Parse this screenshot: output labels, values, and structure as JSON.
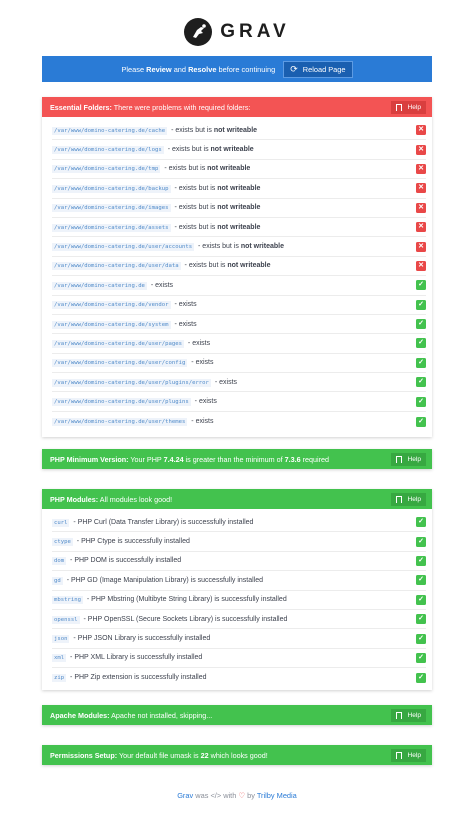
{
  "header": {
    "logo_text": "GRAV"
  },
  "review_bar": {
    "prefix": "Please ",
    "review": "Review",
    "and": " and ",
    "resolve": "Resolve",
    "suffix": " before continuing",
    "reload_label": "Reload Page",
    "reload_icon": "refresh-icon"
  },
  "help_label": "Help",
  "folders": {
    "title": "Essential Folders:",
    "message": " There were problems with required folders:",
    "color": "#f35454",
    "rows": [
      {
        "path": "/var/www/domino-catering.de/cache",
        "text": " - exists but is ",
        "bold": "not writeable",
        "status": "bad",
        "icon": "x-icon"
      },
      {
        "path": "/var/www/domino-catering.de/logs",
        "text": " - exists but is ",
        "bold": "not writeable",
        "status": "bad",
        "icon": "x-icon"
      },
      {
        "path": "/var/www/domino-catering.de/tmp",
        "text": " - exists but is ",
        "bold": "not writeable",
        "status": "bad",
        "icon": "x-icon"
      },
      {
        "path": "/var/www/domino-catering.de/backup",
        "text": " - exists but is ",
        "bold": "not writeable",
        "status": "bad",
        "icon": "x-icon"
      },
      {
        "path": "/var/www/domino-catering.de/images",
        "text": " - exists but is ",
        "bold": "not writeable",
        "status": "bad",
        "icon": "x-icon"
      },
      {
        "path": "/var/www/domino-catering.de/assets",
        "text": " - exists but is ",
        "bold": "not writeable",
        "status": "bad",
        "icon": "x-icon"
      },
      {
        "path": "/var/www/domino-catering.de/user/accounts",
        "text": " - exists but is ",
        "bold": "not writeable",
        "status": "bad",
        "icon": "x-icon"
      },
      {
        "path": "/var/www/domino-catering.de/user/data",
        "text": " - exists but is ",
        "bold": "not writeable",
        "status": "bad",
        "icon": "x-icon"
      },
      {
        "path": "/var/www/domino-catering.de",
        "text": " - exists",
        "bold": "",
        "status": "ok",
        "icon": "check-icon"
      },
      {
        "path": "/var/www/domino-catering.de/vendor",
        "text": " - exists",
        "bold": "",
        "status": "ok",
        "icon": "check-icon"
      },
      {
        "path": "/var/www/domino-catering.de/system",
        "text": " - exists",
        "bold": "",
        "status": "ok",
        "icon": "check-icon"
      },
      {
        "path": "/var/www/domino-catering.de/user/pages",
        "text": " - exists",
        "bold": "",
        "status": "ok",
        "icon": "check-icon"
      },
      {
        "path": "/var/www/domino-catering.de/user/config",
        "text": " - exists",
        "bold": "",
        "status": "ok",
        "icon": "check-icon"
      },
      {
        "path": "/var/www/domino-catering.de/user/plugins/error",
        "text": " - exists",
        "bold": "",
        "status": "ok",
        "icon": "check-icon"
      },
      {
        "path": "/var/www/domino-catering.de/user/plugins",
        "text": " - exists",
        "bold": "",
        "status": "ok",
        "icon": "check-icon"
      },
      {
        "path": "/var/www/domino-catering.de/user/themes",
        "text": " - exists",
        "bold": "",
        "status": "ok",
        "icon": "check-icon"
      }
    ]
  },
  "php_min": {
    "title": "PHP Minimum Version:",
    "msg1": " Your PHP ",
    "version": "7.4.24",
    "msg2": " is greater than the minimum of ",
    "minimum": "7.3.6",
    "msg3": " required"
  },
  "modules": {
    "title": "PHP Modules:",
    "message": " All modules look good!",
    "rows": [
      {
        "code": "curl",
        "text": " - PHP Curl (Data Transfer Library) is successfully installed"
      },
      {
        "code": "ctype",
        "text": " - PHP Ctype is successfully installed"
      },
      {
        "code": "dom",
        "text": " - PHP DOM is successfully installed"
      },
      {
        "code": "gd",
        "text": " - PHP GD (Image Manipulation Library) is successfully installed"
      },
      {
        "code": "mbstring",
        "text": " - PHP Mbstring (Multibyte String Library) is successfully installed"
      },
      {
        "code": "openssl",
        "text": " - PHP OpenSSL (Secure Sockets Library) is successfully installed"
      },
      {
        "code": "json",
        "text": " - PHP JSON Library is successfully installed"
      },
      {
        "code": "xml",
        "text": " - PHP XML Library is successfully installed"
      },
      {
        "code": "zip",
        "text": " - PHP Zip extension is successfully installed"
      }
    ]
  },
  "apache": {
    "title": "Apache Modules:",
    "message": " Apache not installed, skipping..."
  },
  "permissions": {
    "title": "Permissions Setup:",
    "msg1": " Your default file umask is ",
    "umask": "22",
    "msg2": " which looks good!"
  },
  "footer": {
    "grav": "Grav",
    "was": " was ",
    "code_glyph": "</>",
    "with": " with ",
    "heart": "♡",
    "by": " by ",
    "trilby": "Trilby Media"
  },
  "colors": {
    "accent": "#2a7bd6",
    "error": "#f35454",
    "success": "#43c24e"
  }
}
